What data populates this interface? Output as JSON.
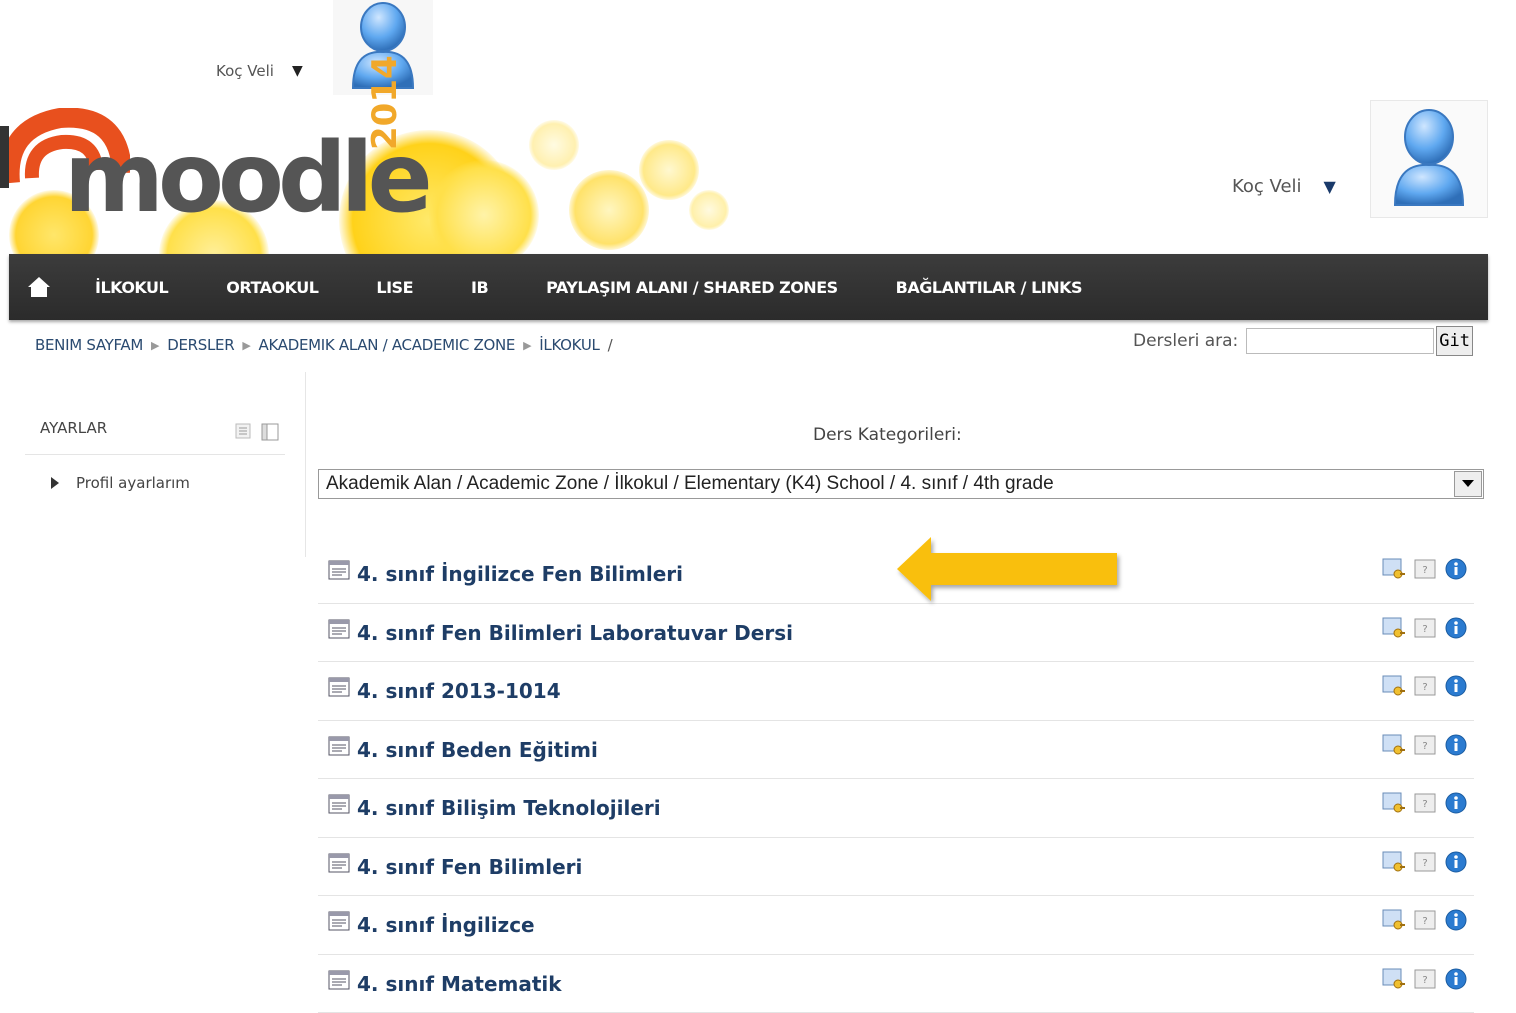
{
  "top_user": {
    "name": "Koç Veli",
    "caret": "▼"
  },
  "header": {
    "logo_text": "moodle",
    "logo_year": "2014",
    "user_name": "Koç Veli",
    "caret": "▼"
  },
  "nav": {
    "items": [
      {
        "label": "İLKOKUL"
      },
      {
        "label": "ORTAOKUL"
      },
      {
        "label": "LISE"
      },
      {
        "label": "IB"
      },
      {
        "label": "PAYLAŞIM ALANI / SHARED ZONES"
      },
      {
        "label": "BAĞLANTILAR / LINKS"
      }
    ]
  },
  "breadcrumb": {
    "items": [
      "BENIM SAYFAM",
      "DERSLER",
      "AKADEMIK ALAN / ACADEMIC ZONE",
      "İLKOKUL"
    ],
    "trailing": "/"
  },
  "search": {
    "label": "Dersleri ara:",
    "value": "",
    "button": "Git"
  },
  "settings_block": {
    "title": "AYARLAR",
    "items": [
      {
        "label": "Profil ayarlarım"
      }
    ]
  },
  "categories": {
    "label": "Ders Kategorileri:",
    "selected": "Akademik Alan / Academic Zone / İlkokul / Elementary (K4) School / 4. sınıf / 4th grade"
  },
  "courses": [
    {
      "name": "4. sınıf İngilizce Fen Bilimleri"
    },
    {
      "name": "4. sınıf Fen Bilimleri Laboratuvar Dersi"
    },
    {
      "name": "4. sınıf 2013-1014"
    },
    {
      "name": "4. sınıf Beden Eğitimi"
    },
    {
      "name": "4. sınıf Bilişim Teknolojileri"
    },
    {
      "name": "4. sınıf Fen Bilimleri"
    },
    {
      "name": "4. sınıf İngilizce"
    },
    {
      "name": "4. sınıf Matematik"
    }
  ],
  "colors": {
    "nav_bg": "#333333",
    "link": "#1e3d66",
    "arrow": "#f9bf0c",
    "logo_orange": "#e8501e"
  }
}
